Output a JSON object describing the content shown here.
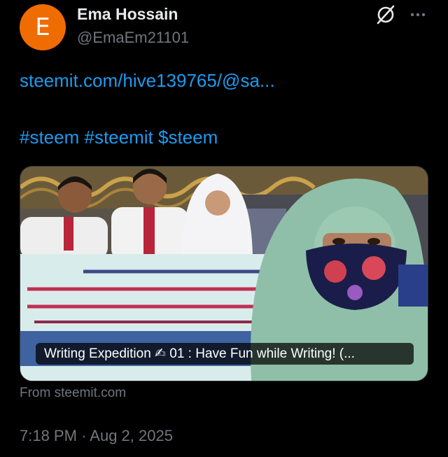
{
  "author": {
    "avatar_letter": "E",
    "avatar_color": "#ef6c00",
    "name": "Ema Hossain",
    "handle": "@EmaEm21101"
  },
  "header_icons": [
    "grok-icon",
    "more-options-icon"
  ],
  "post": {
    "link": "steemit.com/hive139765/@sa...",
    "hashtags": [
      "#steem",
      "#steemit",
      "$steem"
    ]
  },
  "card": {
    "title": "Writing Expedition ✍ 01 : Have Fun while Writing! (...",
    "source": "From steemit.com"
  },
  "meta": {
    "time": "7:18 PM",
    "separator": "·",
    "date": "Aug 2, 2025"
  },
  "colors": {
    "background": "#000000",
    "link": "#1d9bf0",
    "muted": "#71767b",
    "text": "#e7e9ea"
  }
}
